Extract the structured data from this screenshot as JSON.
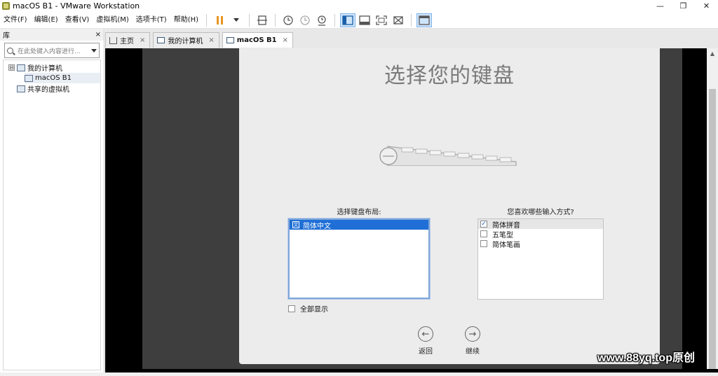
{
  "window": {
    "title": "macOS B1 - VMware Workstation",
    "minimize": "—",
    "restore": "❐",
    "close": "✕"
  },
  "menu": [
    "文件(F)",
    "编辑(E)",
    "查看(V)",
    "虚拟机(M)",
    "选项卡(T)",
    "帮助(H)"
  ],
  "toolbar": {
    "icons": [
      "pause-icon",
      "send-keys-icon",
      "snapshot-icon",
      "revert-snapshot-icon",
      "snapshot-manager-icon",
      "view-library-icon",
      "view-thumbnail-icon",
      "fullscreen-icon",
      "unity-icon",
      "console-view-icon"
    ]
  },
  "sidebar": {
    "title": "库",
    "close": "×",
    "search_placeholder": "在此处键入内容进行...",
    "tree": {
      "root": "我的计算机",
      "expander": "⊟",
      "vm": "macOS B1",
      "shared": "共享的虚拟机"
    }
  },
  "tabs": [
    {
      "label": "主页",
      "close": "×"
    },
    {
      "label": "我的计算机",
      "close": "×"
    },
    {
      "label": "macOS B1",
      "close": "×"
    }
  ],
  "guest": {
    "title": "选择您的键盘",
    "layout_label": "选择键盘布局:",
    "layouts": [
      {
        "name": "简体中文",
        "selected": true
      }
    ],
    "ime_label": "您喜欢哪些输入方式?",
    "ime": [
      {
        "name": "简体拼音",
        "checked": true
      },
      {
        "name": "五笔型",
        "checked": false
      },
      {
        "name": "简体笔画",
        "checked": false
      }
    ],
    "show_all": "全部显示",
    "back": "返回",
    "continue": "继续"
  },
  "watermark": "www.88yq.top原创",
  "colors": {
    "accent": "#1f6fd6",
    "pause": "#e89622"
  }
}
